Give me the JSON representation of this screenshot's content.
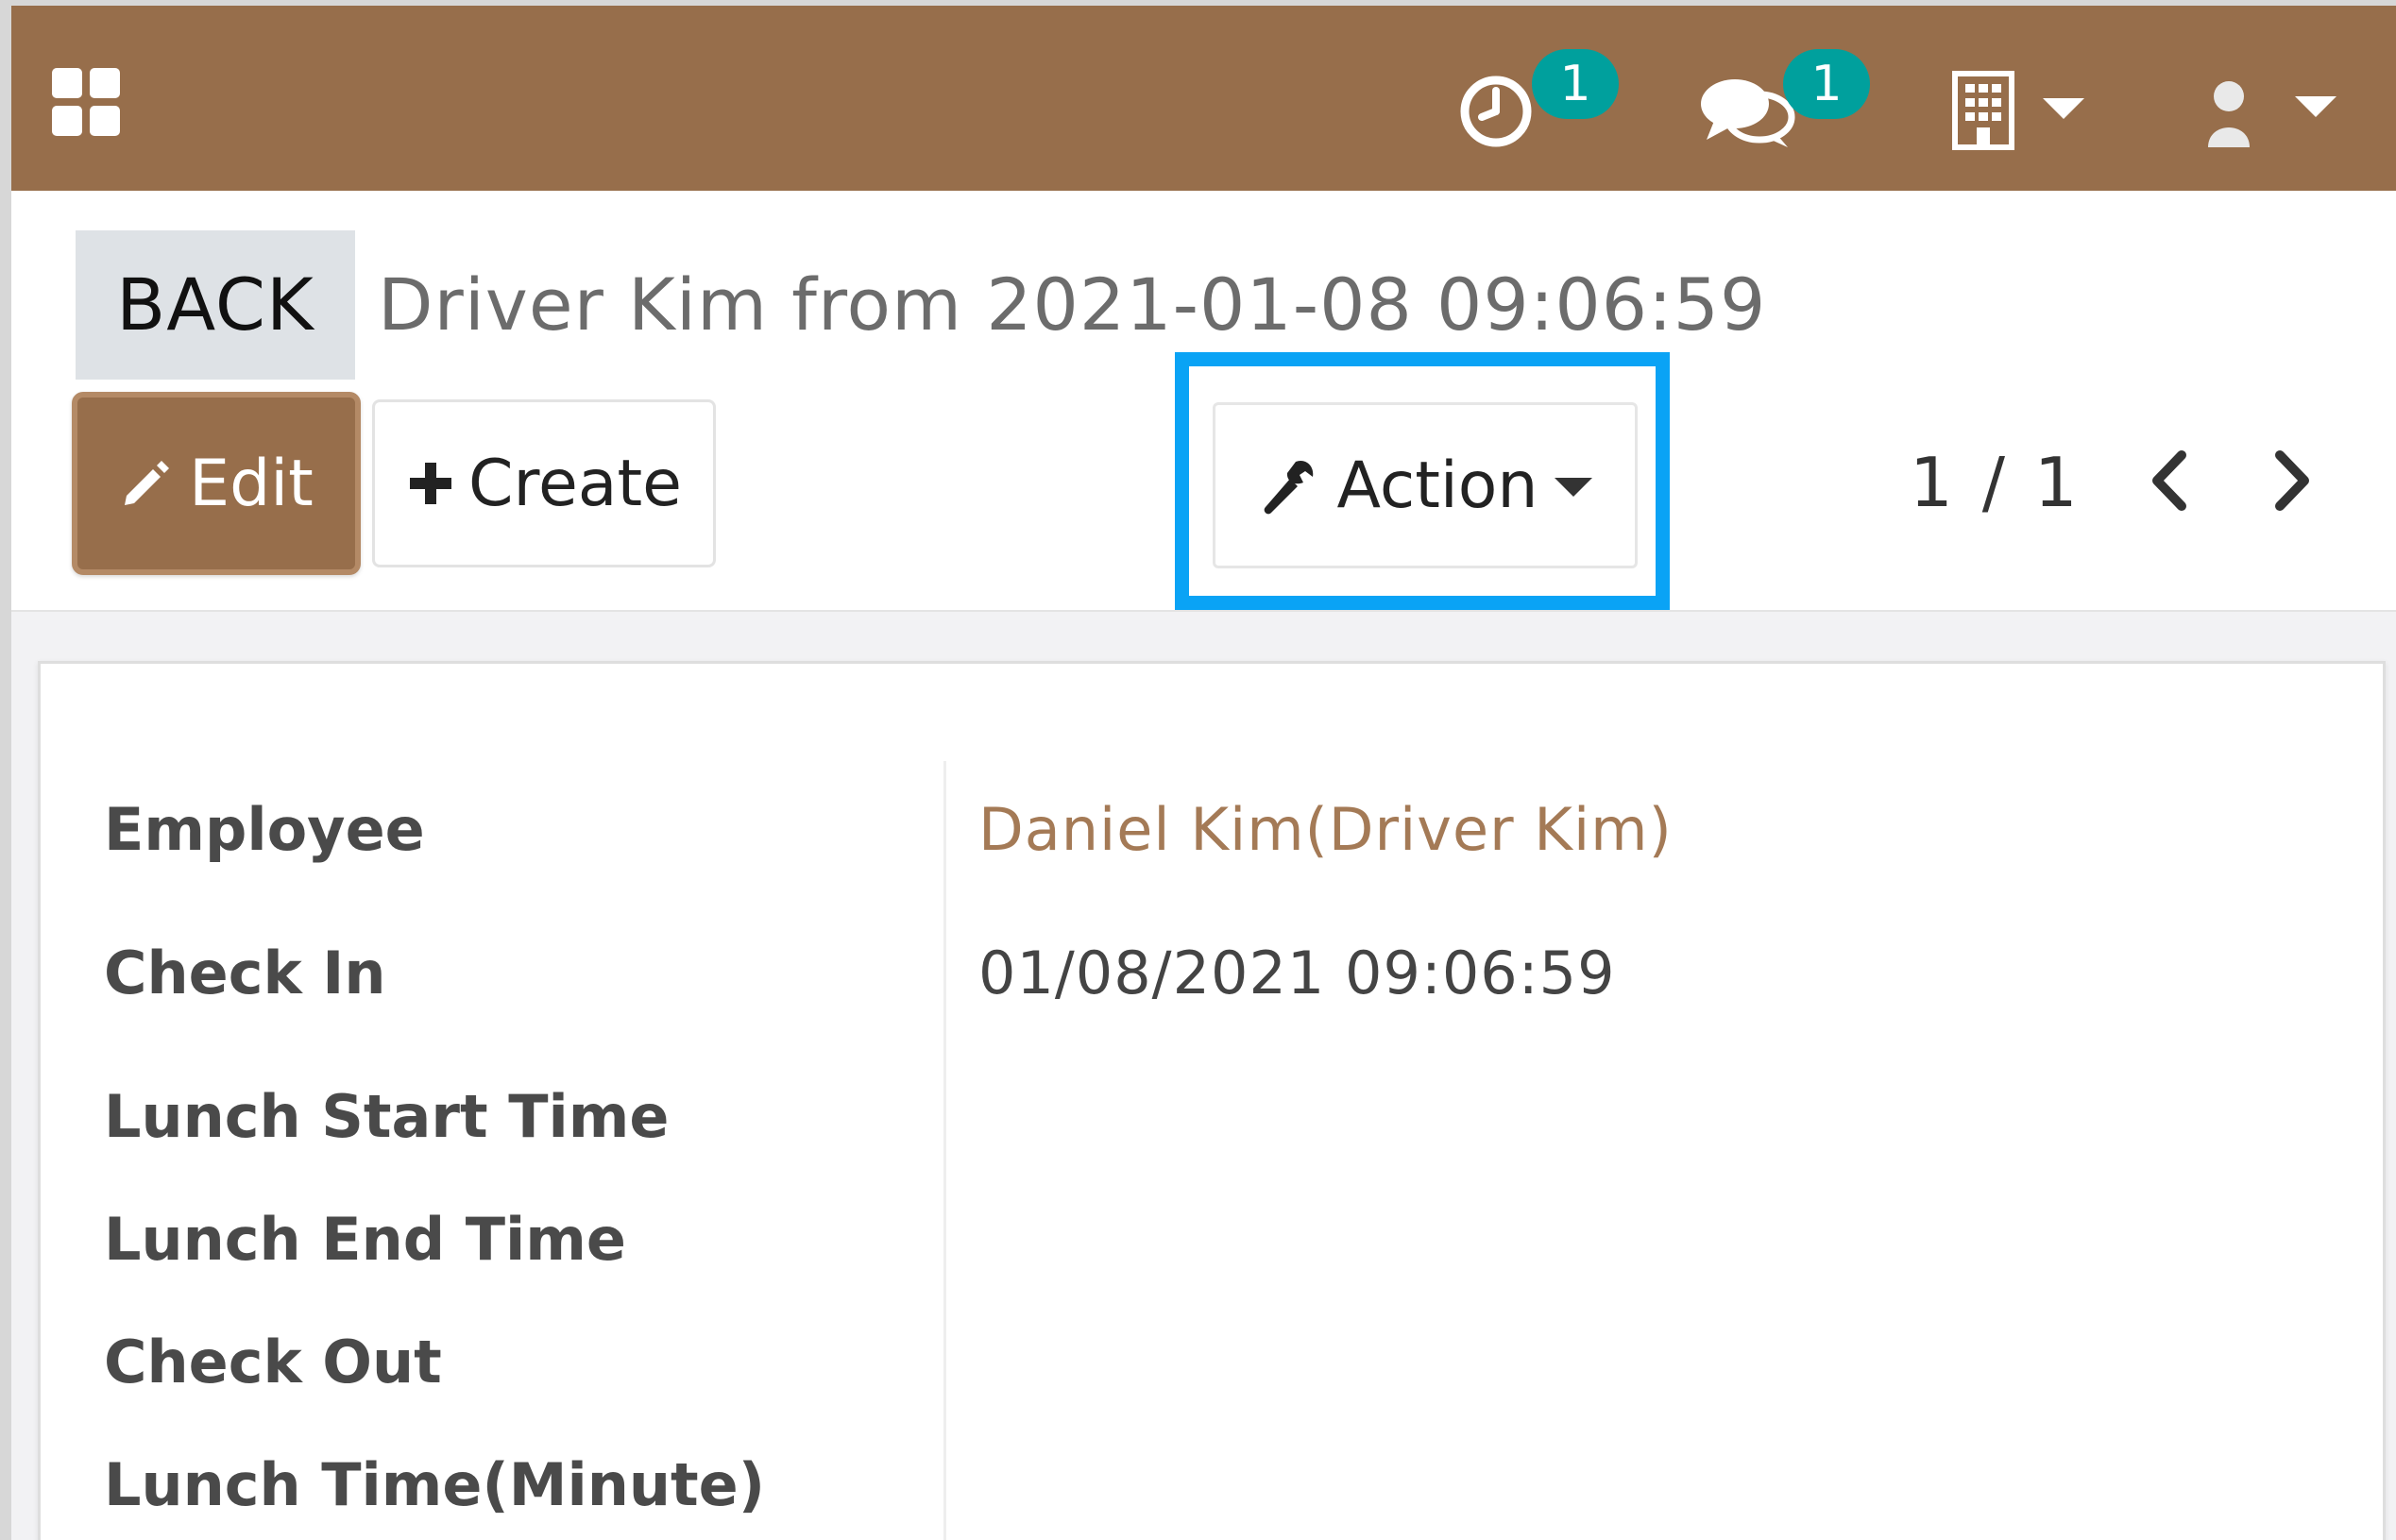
{
  "navbar": {
    "apps_icon": "apps-grid-icon",
    "activity_icon": "clock-icon",
    "activity_count": "1",
    "messages_icon": "chat-icon",
    "messages_count": "1",
    "company_icon": "building-icon",
    "user_icon": "user-avatar-icon",
    "background_color": "#976e4b",
    "badge_color": "#00a09d"
  },
  "control_panel": {
    "back_label": "BACK",
    "record_title": "Driver Kim from 2021-01-08 09:06:59",
    "edit_label": "Edit",
    "create_label": "Create",
    "action_label": "Action",
    "pager_value": "1 / 1",
    "highlight_color": "#0aa3f5"
  },
  "form": {
    "fields": [
      {
        "label": "Employee",
        "value": "Daniel Kim(Driver Kim)"
      },
      {
        "label": "Check In",
        "value": "01/08/2021 09:06:59"
      },
      {
        "label": "Lunch Start Time",
        "value": ""
      },
      {
        "label": "Lunch End Time",
        "value": ""
      },
      {
        "label": "Check Out",
        "value": ""
      },
      {
        "label": "Lunch Time(Minute)",
        "value": ""
      }
    ]
  }
}
